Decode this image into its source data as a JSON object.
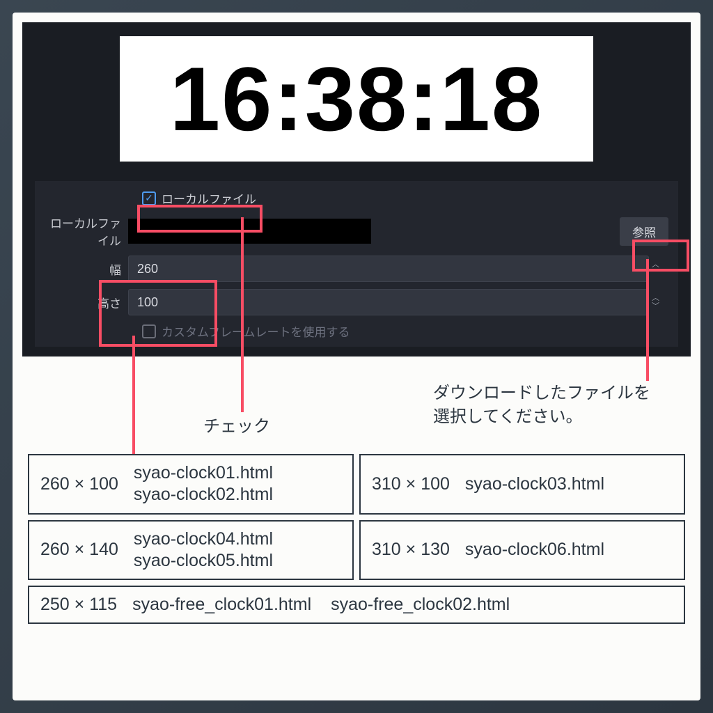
{
  "clock_time": "16:38:18",
  "settings": {
    "local_file_checkbox_label": "ローカルファイル",
    "local_file_label": "ローカルファイル",
    "browse_button": "参照",
    "width_label": "幅",
    "width_value": "260",
    "height_label": "高さ",
    "height_value": "100",
    "custom_framerate_label": "カスタムフレームレートを使用する"
  },
  "annotations": {
    "check": "チェック",
    "download": "ダウンロードしたファイルを\n選択してください。"
  },
  "size_table": [
    [
      {
        "dim": "260 × 100",
        "files": [
          "syao-clock01.html",
          "syao-clock02.html"
        ]
      },
      {
        "dim": "310 × 100",
        "files": [
          "syao-clock03.html"
        ]
      }
    ],
    [
      {
        "dim": "260 × 140",
        "files": [
          "syao-clock04.html",
          "syao-clock05.html"
        ]
      },
      {
        "dim": "310 × 130",
        "files": [
          "syao-clock06.html"
        ]
      }
    ],
    [
      {
        "dim": "250 × 115",
        "files": [
          "syao-free_clock01.html",
          "syao-free_clock02.html"
        ],
        "inline": true
      }
    ]
  ]
}
